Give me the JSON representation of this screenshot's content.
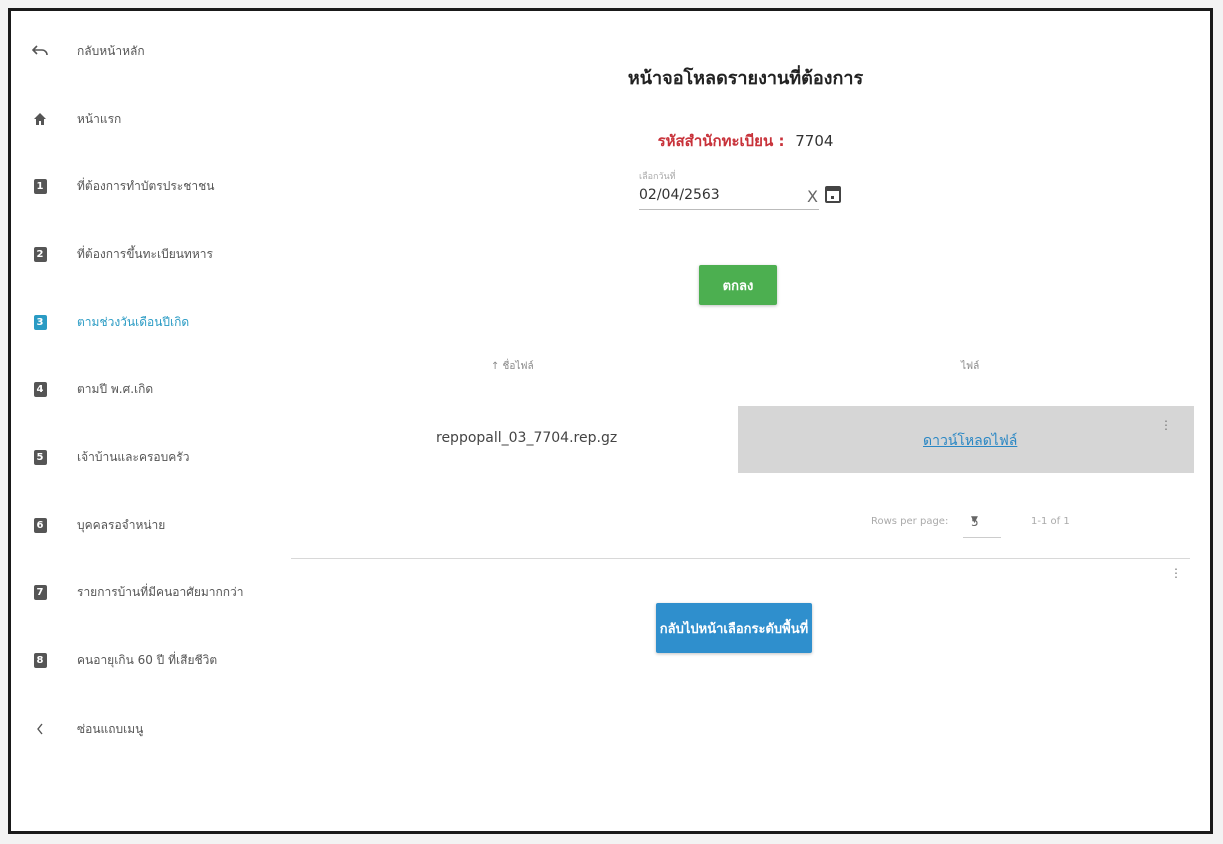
{
  "sidebar": {
    "items": [
      {
        "icon": "undo-icon",
        "label": "กลับหน้าหลัก"
      },
      {
        "icon": "home-icon",
        "label": "หน้าแรก"
      },
      {
        "icon": "number-1-icon",
        "badge": "1",
        "label": "ที่ต้องการทำบัตรประชาชน"
      },
      {
        "icon": "number-2-icon",
        "badge": "2",
        "label": "ที่ต้องการขึ้นทะเบียนทหาร"
      },
      {
        "icon": "number-3-icon",
        "badge": "3",
        "label": "ตามช่วงวันเดือนปีเกิด",
        "active": true
      },
      {
        "icon": "number-4-icon",
        "badge": "4",
        "label": "ตามปี พ.ศ.เกิด"
      },
      {
        "icon": "number-5-icon",
        "badge": "5",
        "label": "เจ้าบ้านและครอบครัว"
      },
      {
        "icon": "number-6-icon",
        "badge": "6",
        "label": "บุคคลรอจำหน่าย"
      },
      {
        "icon": "number-7-icon",
        "badge": "7",
        "label": "รายการบ้านที่มีคนอาศัยมากกว่า"
      },
      {
        "icon": "number-8-icon",
        "badge": "8",
        "label": "คนอายุเกิน 60 ปี ที่เสียชีวิต"
      },
      {
        "icon": "chevron-left-icon",
        "label": "ซ่อนแถบเมนู"
      }
    ]
  },
  "main": {
    "title": "หน้าจอโหลดรายงานที่ต้องการ",
    "office_label": "รหัสสำนักทะเบียน :",
    "office_code": "7704",
    "date_caption": "เลือกวันที่",
    "date_value": "02/04/2563",
    "clear_symbol": "X",
    "ok_label": "ตกลง",
    "table": {
      "col_file": "↑ ชื่อไฟล์",
      "col_action": "ไฟล์",
      "rows": [
        {
          "file": "reppopall_03_7704.rep.gz",
          "action": "ดาวน์โหลดไฟล์"
        }
      ],
      "row_menu": "⋮",
      "rows_per_page_label": "Rows per page:",
      "rows_per_page": "5",
      "page_info": "1-1 of 1"
    },
    "back_label": "กลับไปหน้าเลือกระดับพื้นที่"
  },
  "colors": {
    "accent_blue": "#2f8fcd",
    "ok_green": "#4caf50",
    "office_red": "#c8323a",
    "active_nav": "#2a9bc4"
  }
}
